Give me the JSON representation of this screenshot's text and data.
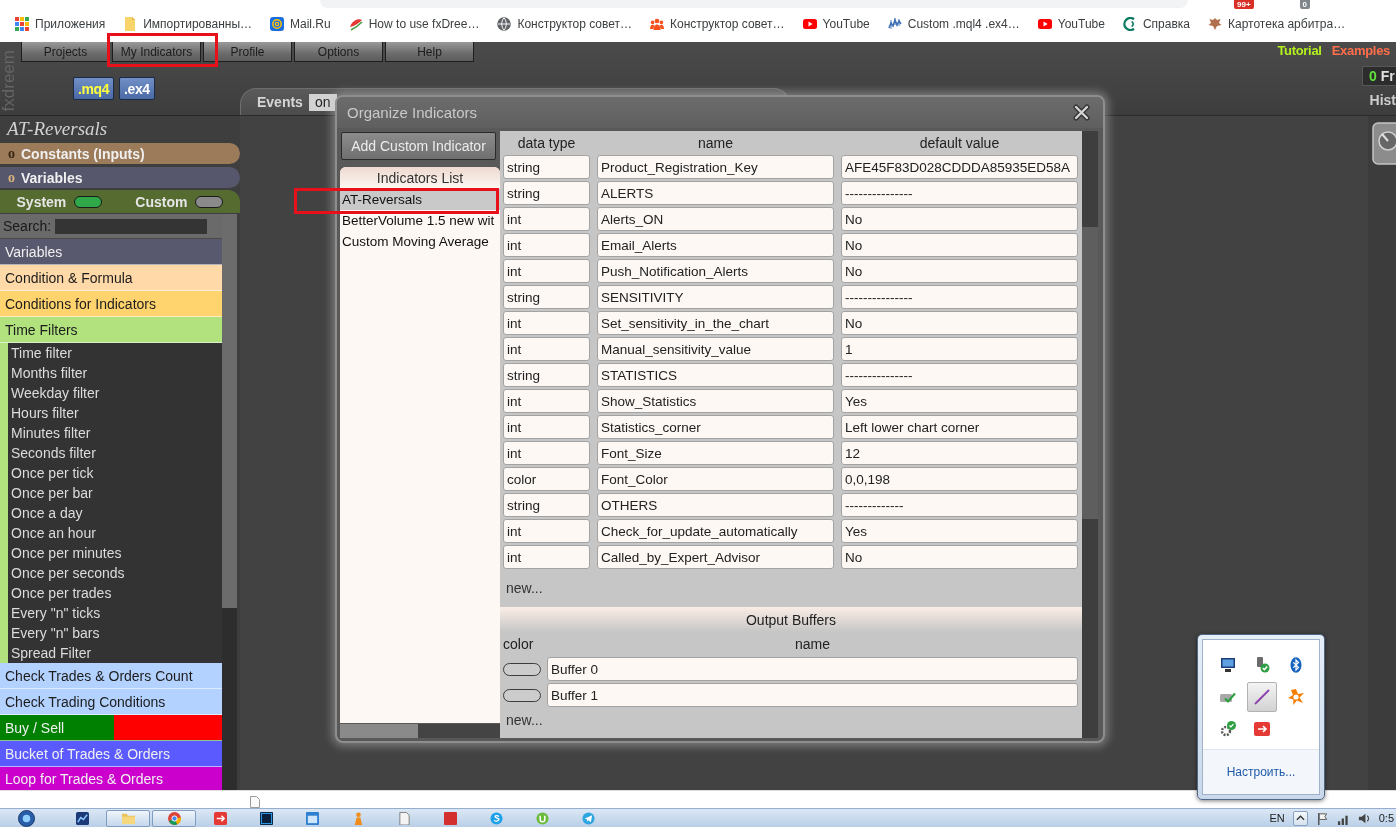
{
  "browser": {
    "extension_badges": [
      {
        "text": "99+",
        "color": "#d93025"
      },
      {
        "text": "0",
        "color": "#80868b"
      }
    ],
    "bookmarks": [
      {
        "kind": "apps",
        "label": "Приложения"
      },
      {
        "kind": "folder",
        "label": "Импортированны…"
      },
      {
        "kind": "mail",
        "label": "Mail.Ru"
      },
      {
        "kind": "logo",
        "label": "How to use fxDree…"
      },
      {
        "kind": "globe",
        "label": "Конструктор совет…"
      },
      {
        "kind": "people",
        "label": "Конструктор совет…"
      },
      {
        "kind": "video",
        "label": "YouTube"
      },
      {
        "kind": "chart",
        "label": "Custom .mql4 .ex4…"
      },
      {
        "kind": "video",
        "label": "YouTube"
      },
      {
        "kind": "help",
        "label": "Справка"
      },
      {
        "kind": "emblem",
        "label": "Картотека арбитра…"
      }
    ]
  },
  "app": {
    "logo": "fxdreem",
    "menu": [
      {
        "label": "Projects",
        "marked": false
      },
      {
        "label": "My Indicators",
        "marked": true
      },
      {
        "label": "Profile",
        "marked": false
      },
      {
        "label": "Options",
        "marked": false
      },
      {
        "label": "Help",
        "marked": false
      }
    ],
    "file_buttons": [
      {
        "label": ".mq4",
        "color": "#ffff3c"
      },
      {
        "label": ".ex4",
        "color": "#ffffff"
      }
    ],
    "events": {
      "label": "Events",
      "toggle": "on"
    },
    "links": [
      {
        "label": "Tutorial",
        "color": "#b4f01e"
      },
      {
        "label": "Examples",
        "color": "#ff6e4a"
      }
    ],
    "counter": {
      "value": "0",
      "label": "Fr"
    },
    "history": "Hist",
    "sidebar": {
      "title": "AT-Reversals",
      "sections": [
        {
          "marker": "o",
          "label": "Constants (Inputs)",
          "color": "#9c7b5a"
        },
        {
          "marker": "o",
          "label": "Variables",
          "color": "#56566c"
        }
      ],
      "filters": [
        {
          "label": "System",
          "on": true
        },
        {
          "label": "Custom",
          "on": false
        }
      ],
      "search": {
        "label": "Search:"
      },
      "categories": [
        {
          "label": "Variables",
          "color": "#58586e"
        },
        {
          "label": "Condition & Formula",
          "color": "#ffdaa8"
        },
        {
          "label": "Conditions for Indicators",
          "color": "#ffd46e"
        },
        {
          "label": "Time Filters",
          "color": "#b2e27e",
          "children": [
            {
              "label": "Time filter"
            },
            {
              "label": "Months filter"
            },
            {
              "label": "Weekday filter"
            },
            {
              "label": "Hours filter"
            },
            {
              "label": "Minutes filter"
            },
            {
              "label": "Seconds filter"
            },
            {
              "label": "Once per tick"
            },
            {
              "label": "Once per bar"
            },
            {
              "label": "Once a day"
            },
            {
              "label": "Once an hour"
            },
            {
              "label": "Once per minutes"
            },
            {
              "label": "Once per seconds"
            },
            {
              "label": "Once per trades"
            },
            {
              "label": "Every \"n\" ticks"
            },
            {
              "label": "Every \"n\" bars"
            },
            {
              "label": "Spread Filter"
            }
          ]
        },
        {
          "label": "Check Trades & Orders Count",
          "color": "#b4d2ff"
        },
        {
          "label": "Check Trading Conditions",
          "color": "#b4d2ff"
        },
        {
          "label": "Buy / Sell",
          "color": "#008000",
          "accent": {
            "color": "#ff0000"
          }
        },
        {
          "label": "Bucket of Trades & Orders",
          "color": "#5a5aff"
        },
        {
          "label": "Loop for Trades & Orders",
          "color": "#cc00cc"
        }
      ]
    }
  },
  "dialog": {
    "title": "Organize Indicators",
    "add_button": "Add Custom Indicator",
    "list_title": "Indicators List",
    "indicators": [
      {
        "name": "AT-Reversals",
        "selected": true,
        "marked": true
      },
      {
        "name": "BetterVolume 1.5 new wit",
        "selected": false,
        "marked": false
      },
      {
        "name": "Custom Moving Average",
        "selected": false,
        "marked": false
      }
    ],
    "inputs": {
      "columns": [
        "data type",
        "name",
        "default value"
      ],
      "rows": [
        {
          "type": "string",
          "name": "Product_Registration_Key",
          "value": "AFE45F83D028CDDDA85935ED58A"
        },
        {
          "type": "string",
          "name": "ALERTS",
          "value": "---------------"
        },
        {
          "type": "int",
          "name": "Alerts_ON",
          "value": "No"
        },
        {
          "type": "int",
          "name": "Email_Alerts",
          "value": "No"
        },
        {
          "type": "int",
          "name": "Push_Notification_Alerts",
          "value": "No"
        },
        {
          "type": "string",
          "name": "SENSITIVITY",
          "value": "---------------"
        },
        {
          "type": "int",
          "name": "Set_sensitivity_in_the_chart",
          "value": "No"
        },
        {
          "type": "int",
          "name": "Manual_sensitivity_value",
          "value": "1"
        },
        {
          "type": "string",
          "name": "STATISTICS",
          "value": "---------------"
        },
        {
          "type": "int",
          "name": "Show_Statistics",
          "value": "Yes"
        },
        {
          "type": "int",
          "name": "Statistics_corner",
          "value": "Left lower chart corner"
        },
        {
          "type": "int",
          "name": "Font_Size",
          "value": "12"
        },
        {
          "type": "color",
          "name": "Font_Color",
          "value": "0,0,198"
        },
        {
          "type": "string",
          "name": "OTHERS",
          "value": "-------------"
        },
        {
          "type": "int",
          "name": "Check_for_update_automatically",
          "value": "Yes"
        },
        {
          "type": "int",
          "name": "Called_by_Expert_Advisor",
          "value": "No"
        }
      ],
      "new_link": "new..."
    },
    "buffers": {
      "title": "Output Buffers",
      "columns": [
        "color",
        "name"
      ],
      "rows": [
        {
          "color": "#cccccc",
          "name": "Buffer 0"
        },
        {
          "color": "#cccccc",
          "name": "Buffer 1"
        }
      ],
      "new_link": "new..."
    }
  },
  "tray_popup": {
    "icons": [
      {
        "kind": "monitor",
        "selected": false
      },
      {
        "kind": "plug",
        "selected": false
      },
      {
        "kind": "bluetooth",
        "selected": false
      },
      {
        "kind": "card",
        "selected": false
      },
      {
        "kind": "line",
        "selected": true
      },
      {
        "kind": "splat",
        "selected": false
      },
      {
        "kind": "gear",
        "selected": false
      },
      {
        "kind": "arrows",
        "selected": false
      }
    ],
    "customize": "Настроить..."
  },
  "taskbar": {
    "apps": [
      {
        "kind": "chart",
        "active": false
      },
      {
        "kind": "folder",
        "active": true
      },
      {
        "kind": "browser",
        "active": true
      },
      {
        "kind": "arrows",
        "active": false
      },
      {
        "kind": "tile",
        "active": false
      },
      {
        "kind": "window",
        "active": false
      },
      {
        "kind": "figure",
        "active": false
      },
      {
        "kind": "document",
        "active": false
      },
      {
        "kind": "square",
        "active": false
      },
      {
        "kind": "chat",
        "active": false
      },
      {
        "kind": "ring",
        "active": false
      },
      {
        "kind": "plane",
        "active": false
      }
    ],
    "language": "EN",
    "clock": "0:5"
  }
}
